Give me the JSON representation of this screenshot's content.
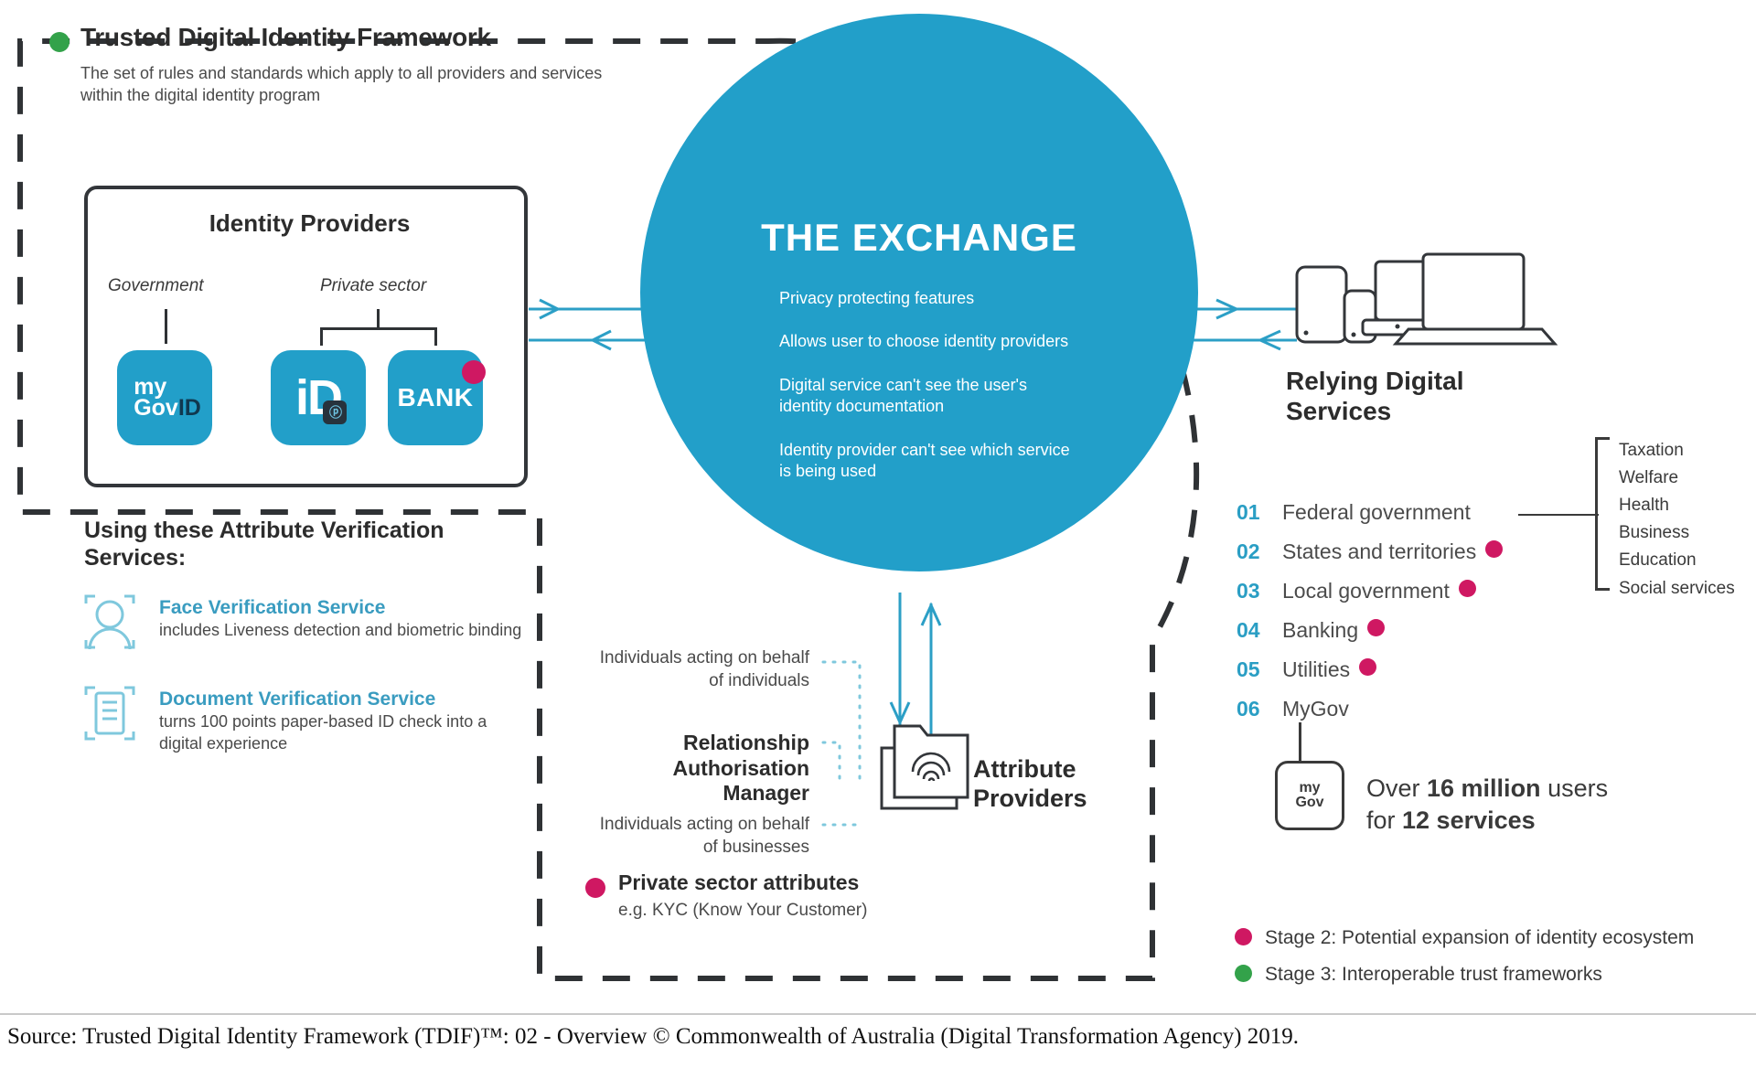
{
  "framework": {
    "title": "Trusted Digital Identity Framework",
    "subtitle": "The set of rules and standards which apply to all providers and services within the digital identity program",
    "dot_color": "#33a24a"
  },
  "identity_providers": {
    "title": "Identity Providers",
    "categories": {
      "government": "Government",
      "private_sector": "Private sector"
    },
    "tiles": [
      {
        "name": "myGovID",
        "line1": "my",
        "line2a": "Gov",
        "line2b": "ID"
      },
      {
        "name": "iD",
        "mark": "iD",
        "badge": "ⓟ"
      },
      {
        "name": "BANK",
        "mark": "BANK",
        "has_stage2_dot": true
      }
    ]
  },
  "attribute_verification": {
    "title": "Using these Attribute Verification Services:",
    "services": [
      {
        "icon": "face-verification-icon",
        "name": "Face Verification Service",
        "description": "includes Liveness detection and biometric binding"
      },
      {
        "icon": "document-verification-icon",
        "name": "Document Verification Service",
        "description": "turns 100 points paper-based ID check into a digital experience"
      }
    ]
  },
  "exchange": {
    "title": "THE EXCHANGE",
    "color": "#229fc9",
    "bullets": [
      "Privacy protecting features",
      "Allows user to choose identity providers",
      "Digital service can't see the user's identity documentation",
      "Identity provider can't see which service is being used"
    ]
  },
  "relying_services": {
    "title": "Relying Digital Services",
    "items": [
      {
        "num": "01",
        "label": "Federal government",
        "stage2": false
      },
      {
        "num": "02",
        "label": "States and territories",
        "stage2": true
      },
      {
        "num": "03",
        "label": "Local government",
        "stage2": true
      },
      {
        "num": "04",
        "label": "Banking",
        "stage2": true
      },
      {
        "num": "05",
        "label": "Utilities",
        "stage2": true
      },
      {
        "num": "06",
        "label": "MyGov",
        "stage2": false
      }
    ],
    "taxonomy": [
      "Taxation",
      "Welfare",
      "Health",
      "Business",
      "Education",
      "Social services"
    ],
    "mygov_stat": {
      "tile_line1": "my",
      "tile_line2": "Gov",
      "prefix": "Over ",
      "users_value": "16 million",
      "users_suffix": " users",
      "services_prefix": "for ",
      "services_value": "12 services"
    }
  },
  "relationship_manager": {
    "individuals_on_individuals": "Individuals acting on behalf of individuals",
    "title": "Relationship Authorisation Manager",
    "individuals_on_businesses": "Individuals acting on behalf of businesses",
    "private_attributes_title": "Private sector attributes",
    "private_attributes_sub": "e.g. KYC (Know Your Customer)"
  },
  "attribute_providers": {
    "title": "Attribute Providers"
  },
  "legend": [
    {
      "color": "#cf1862",
      "label": "Stage 2: Potential expansion of identity ecosystem"
    },
    {
      "color": "#33a24a",
      "label": "Stage 3: Interoperable trust frameworks"
    }
  ],
  "source": "Source: Trusted Digital Identity Framework (TDIF)™: 02 - Overview © Commonwealth of Australia (Digital Transformation Agency) 2019."
}
